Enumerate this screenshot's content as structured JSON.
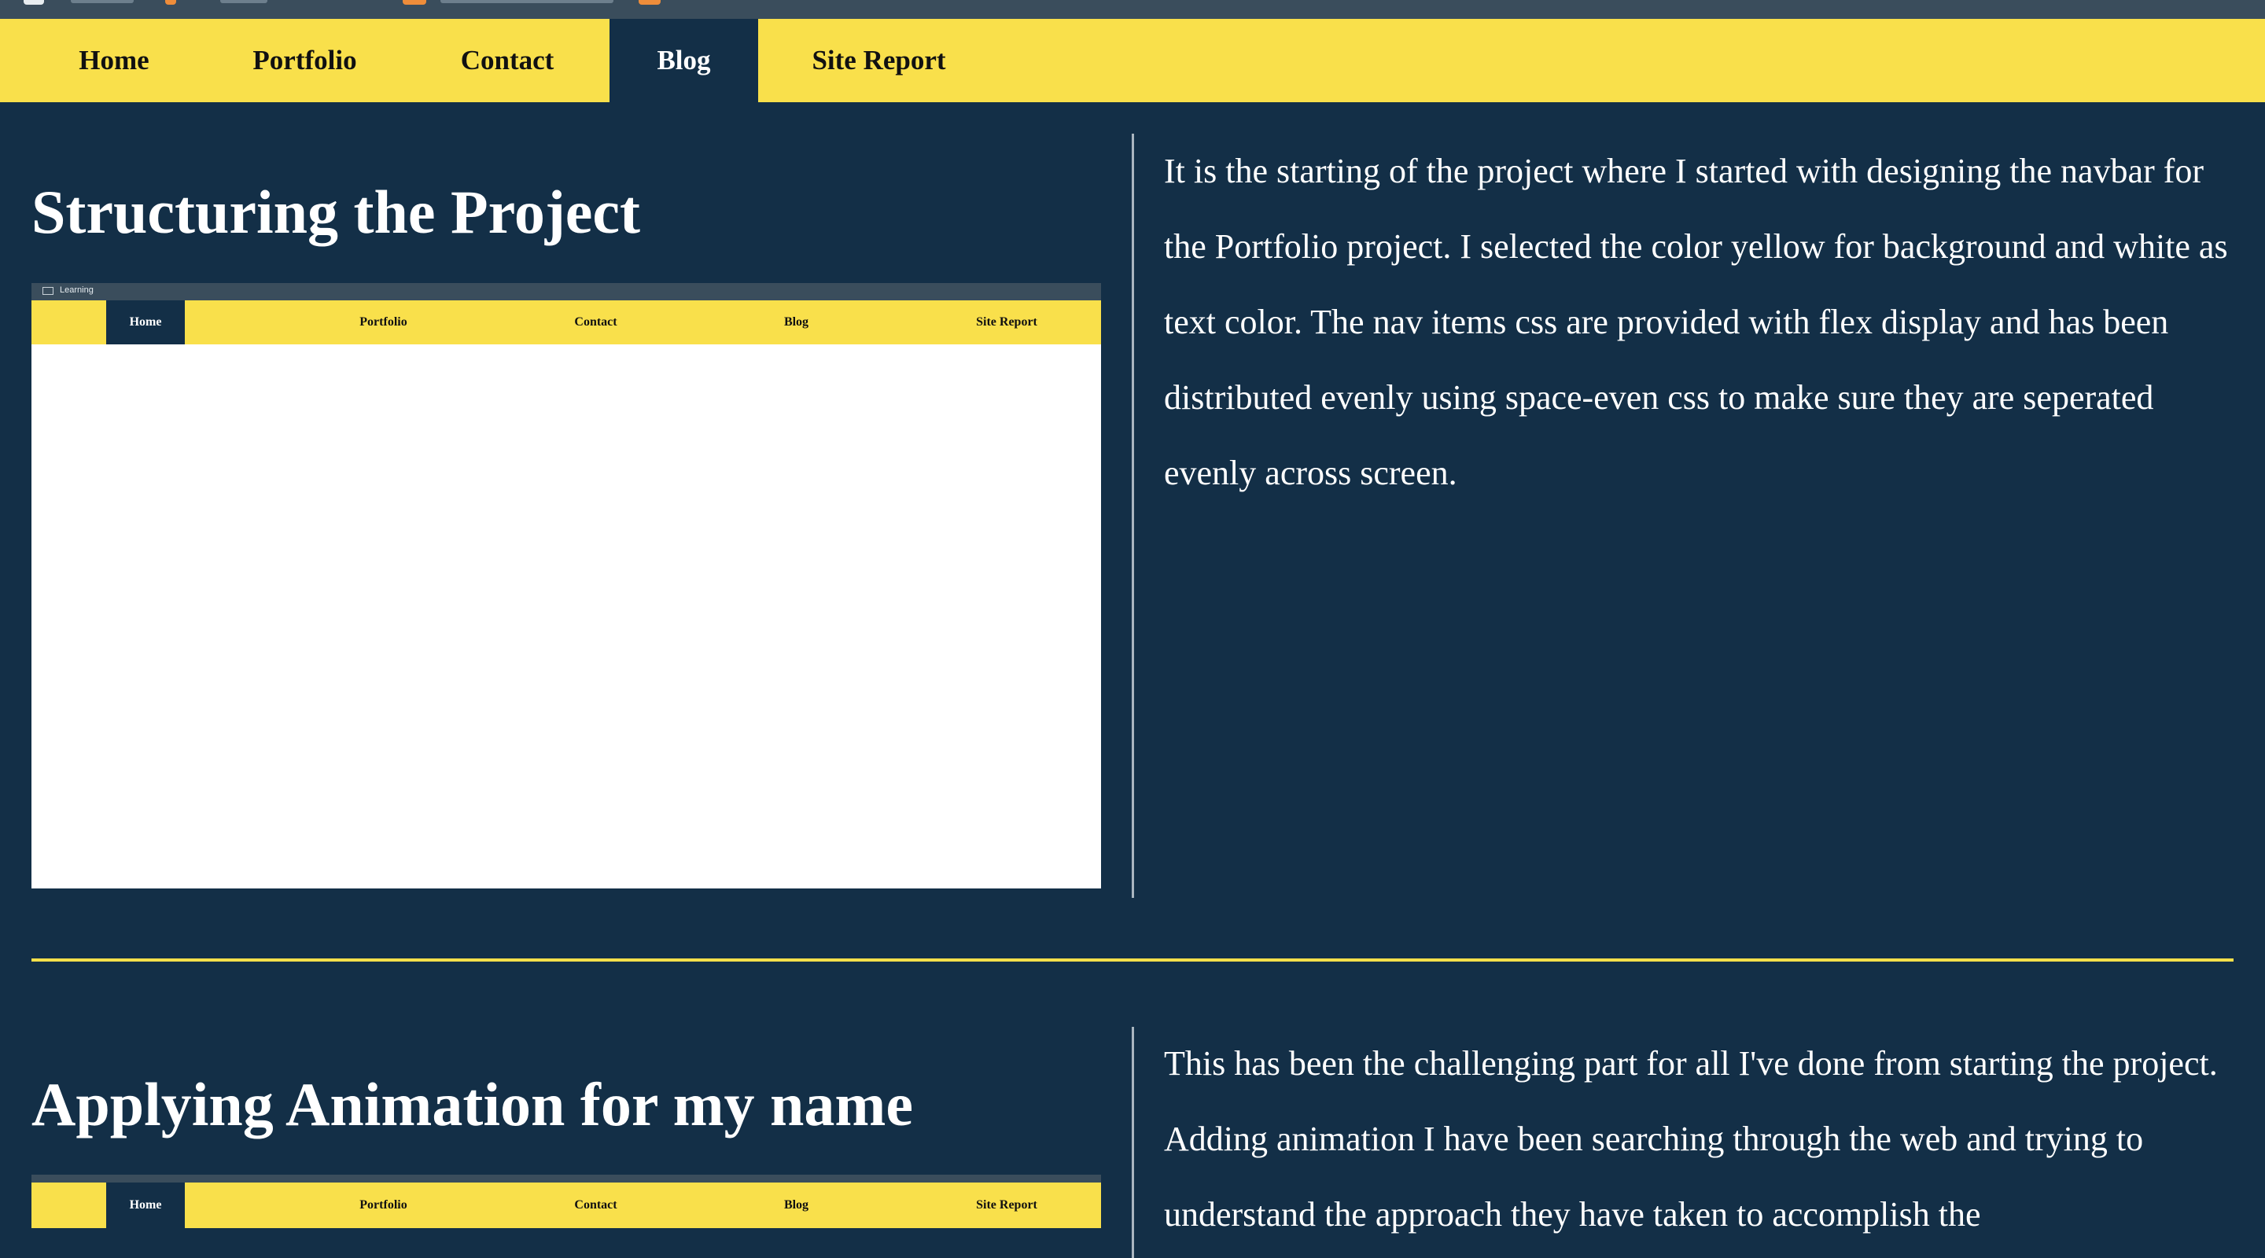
{
  "colors": {
    "background": "#132f47",
    "nav_yellow": "#f9e04b",
    "nav_active_bg": "#132f47",
    "accent_icon": "#ee8d3a"
  },
  "navbar": {
    "items": [
      {
        "label": "Home",
        "active": false
      },
      {
        "label": "Portfolio",
        "active": false
      },
      {
        "label": "Contact",
        "active": false
      },
      {
        "label": "Blog",
        "active": true
      },
      {
        "label": "Site Report",
        "active": false
      }
    ]
  },
  "posts": [
    {
      "title": "Structuring the Project",
      "screenshot": {
        "tab_label": "Learning",
        "nav": [
          "Home",
          "Portfolio",
          "Contact",
          "Blog",
          "Site Report"
        ]
      },
      "text": "It is the starting of the project where I started with designing the navbar for the Portfolio project. I selected the color yellow for background and white as text color. The nav items css are provided with flex display and has been distributed evenly using space-even css to make sure they are seperated evenly across screen."
    },
    {
      "title": "Applying Animation for my name",
      "screenshot": {
        "nav": [
          "Home",
          "Portfolio",
          "Contact",
          "Blog",
          "Site Report"
        ]
      },
      "text": "This has been the challenging part for all I've done from starting the project. Adding animation I have been searching through the web and trying to understand the approach they have taken to accomplish the"
    }
  ]
}
